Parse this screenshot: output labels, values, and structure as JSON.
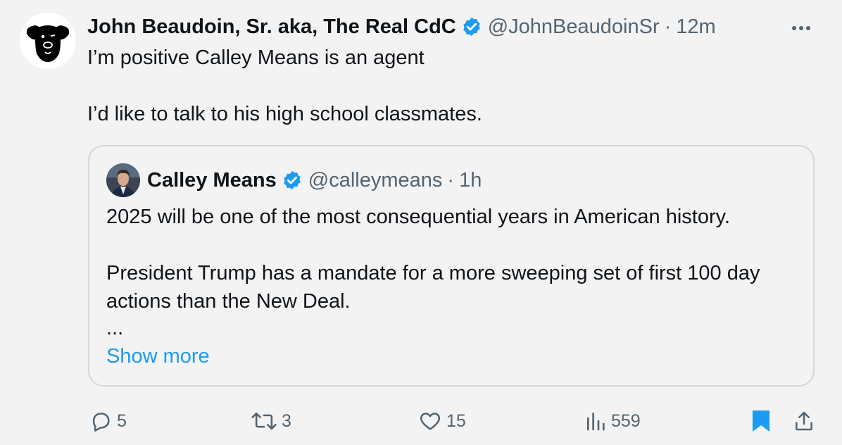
{
  "tweet": {
    "author_name": "John Beaudoin, Sr. aka, The Real CdC",
    "handle": "@JohnBeaudoinSr",
    "separator": "·",
    "time": "12m",
    "avatar_icon": "black-dog-icon",
    "text_line1": "I’m positive Calley Means is an agent",
    "text_line2": "I’d like to talk to his high school classmates."
  },
  "quoted": {
    "author_name": "Calley Means",
    "handle": "@calleymeans",
    "separator": "·",
    "time": "1h",
    "paragraph1": "2025 will be one of the most consequential years in American history.",
    "paragraph2": "President Trump has a mandate for a more sweeping set of first 100 day actions than the New Deal.",
    "ellipsis": "...",
    "show_more": "Show more"
  },
  "actions": {
    "replies": "5",
    "retweets": "3",
    "likes": "15",
    "views": "559"
  },
  "colors": {
    "background": "#f3f3f3",
    "accent": "#1d9bf0",
    "muted": "#536471",
    "text": "#0f1419",
    "border": "#cfd9de"
  }
}
